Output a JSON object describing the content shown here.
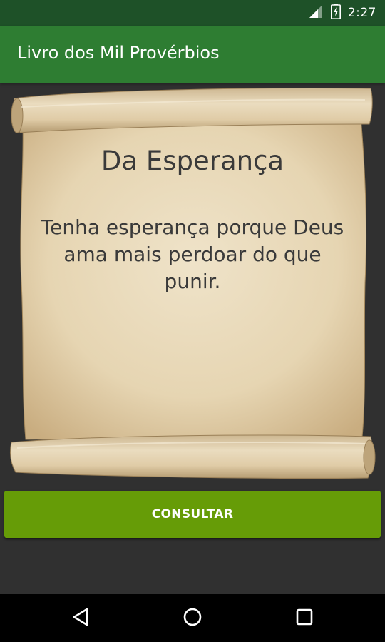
{
  "status_bar": {
    "time": "2:27",
    "icons": [
      "signal-icon",
      "battery-charging-icon"
    ]
  },
  "app_bar": {
    "title": "Livro dos Mil Provérbios",
    "background": "#2e7d32"
  },
  "proverb": {
    "title": "Da Esperança",
    "text": "Tenha esperança porque Deus ama mais perdoar do que punir."
  },
  "consult_button": {
    "label": "CONSULTAR",
    "color": "#669c07"
  },
  "nav_bar": {
    "buttons": [
      "back-icon",
      "home-icon",
      "recents-icon"
    ]
  }
}
